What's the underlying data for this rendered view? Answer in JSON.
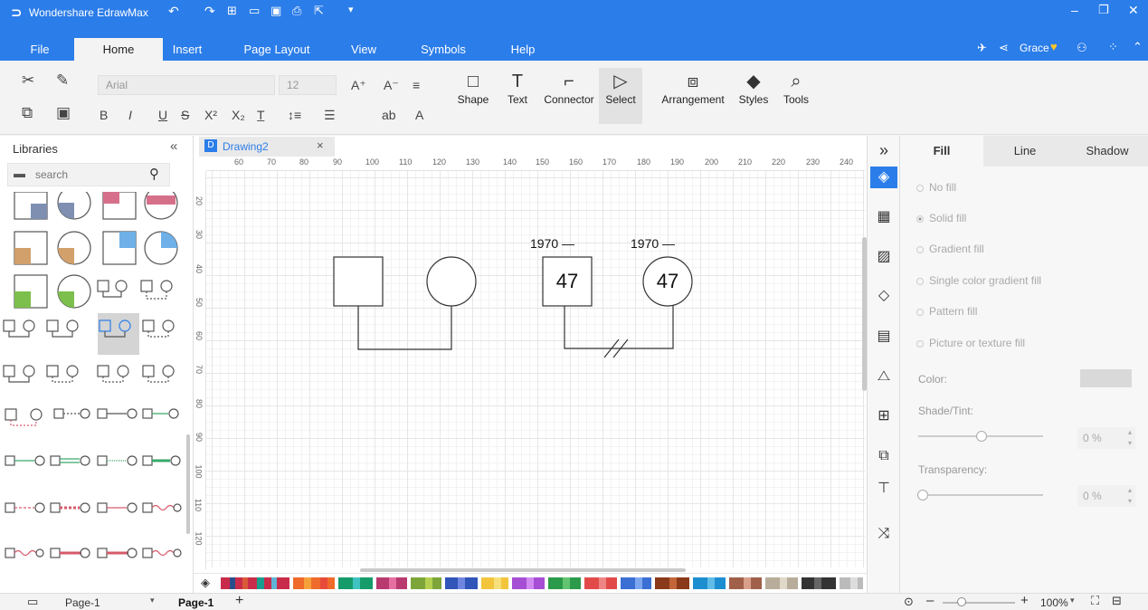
{
  "app": {
    "title": "Wondershare EdrawMax",
    "user": "Grace"
  },
  "menu": {
    "tabs": [
      "File",
      "Home",
      "Insert",
      "Page Layout",
      "View",
      "Symbols",
      "Help"
    ],
    "active": "Home"
  },
  "ribbon": {
    "font_family": "Arial",
    "font_size": "12",
    "buttons": {
      "shape": "Shape",
      "text": "Text",
      "connector": "Connector",
      "select": "Select",
      "arrangement": "Arrangement",
      "styles": "Styles",
      "tools": "Tools"
    },
    "format_glyphs": {
      "bold": "B",
      "italic": "I",
      "underline": "U",
      "strike": "S",
      "superscript": "X²",
      "subscript": "X₂",
      "ab": "ab",
      "font_color": "A"
    }
  },
  "libraries": {
    "title": "Libraries",
    "search_placeholder": "search"
  },
  "document": {
    "tab_name": "Drawing2",
    "ruler_h": [
      "60",
      "70",
      "80",
      "90",
      "100",
      "110",
      "120",
      "130",
      "140",
      "150",
      "160",
      "170",
      "180",
      "190",
      "200",
      "210",
      "220",
      "230",
      "240"
    ],
    "ruler_v": [
      "20",
      "30",
      "40",
      "50",
      "60",
      "70",
      "80",
      "90",
      "100",
      "110",
      "120"
    ]
  },
  "diagram": {
    "left_year": "1970 —",
    "right_year": "1970 —",
    "square_age": "47",
    "circle_age": "47",
    "stroke_color": "#333333"
  },
  "right_panel": {
    "tabs": [
      "Fill",
      "Line",
      "Shadow"
    ],
    "active_tab": "Fill",
    "fill_options": [
      "No fill",
      "Solid fill",
      "Gradient fill",
      "Single color gradient fill",
      "Pattern fill",
      "Picture or texture fill"
    ],
    "selected_fill": "Solid fill",
    "color_label": "Color:",
    "color_value": "#d9d9d9",
    "shade_label": "Shade/Tint:",
    "shade_value": "0 %",
    "shade_level": 0.5,
    "transparency_label": "Transparency:",
    "transparency_value": "0 %",
    "transparency_level": 0
  },
  "status": {
    "page_selector": "Page-1",
    "page_tab": "Page-1",
    "zoom": "100%"
  },
  "colors": {
    "title_bar": "#2b7de9",
    "accent": "#2b7de9"
  }
}
